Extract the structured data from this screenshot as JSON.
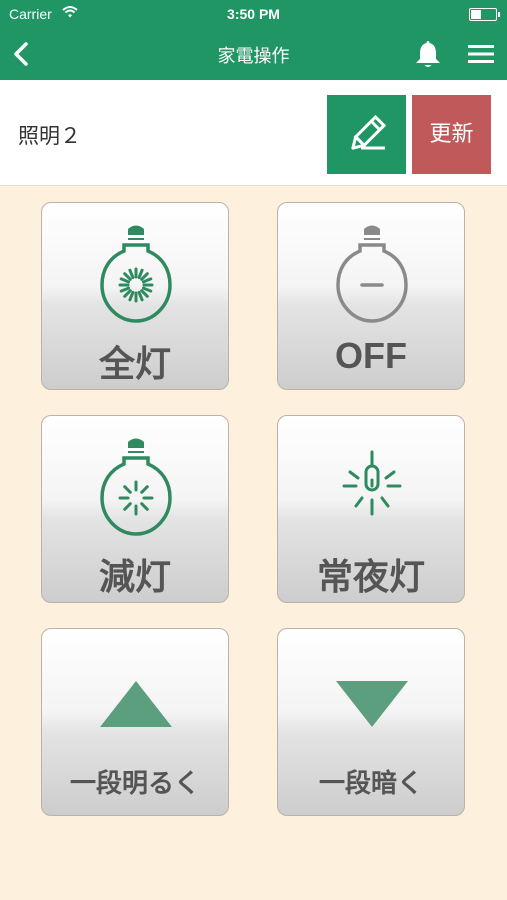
{
  "status_bar": {
    "carrier": "Carrier",
    "time": "3:50 PM"
  },
  "nav": {
    "title": "家電操作"
  },
  "header": {
    "device_name": "照明２",
    "update_label": "更新"
  },
  "controls": [
    {
      "label": "全灯",
      "icon": "bulb-full-icon"
    },
    {
      "label": "OFF",
      "icon": "bulb-off-icon"
    },
    {
      "label": "減灯",
      "icon": "bulb-dim-icon"
    },
    {
      "label": "常夜灯",
      "icon": "night-light-icon"
    },
    {
      "label": "一段明るく",
      "icon": "triangle-up-icon"
    },
    {
      "label": "一段暗く",
      "icon": "triangle-down-icon"
    }
  ],
  "colors": {
    "primary": "#1f9664",
    "update": "#c05a5a",
    "background": "#fdf0dc",
    "icon_green": "#2f8a60"
  }
}
